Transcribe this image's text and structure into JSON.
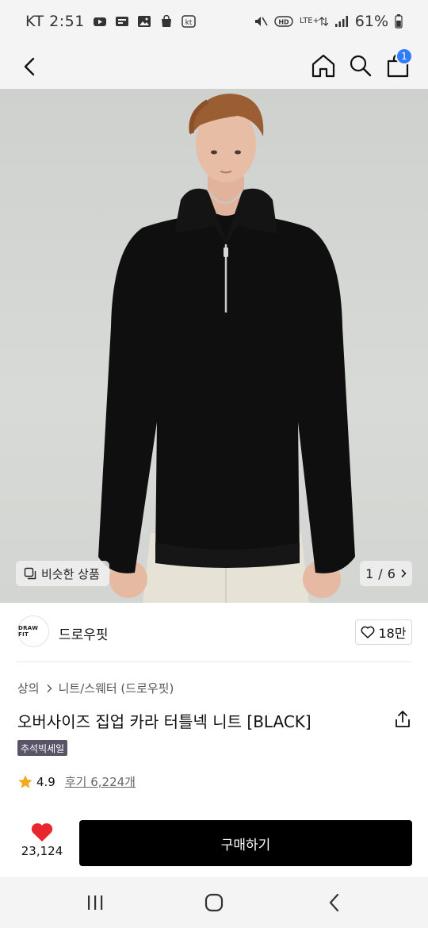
{
  "status_bar": {
    "carrier_time": "KT 2:51",
    "carrier_badge": "kt",
    "network": "LTE+",
    "hd_label": "HD",
    "battery": "61%",
    "icons": [
      "youtube-icon",
      "message-icon",
      "gallery-icon",
      "shopping-bag-icon",
      "kt-icon",
      "mute-icon",
      "hd-voice-icon",
      "lte-icon",
      "signal-icon",
      "battery-icon"
    ]
  },
  "header": {
    "icons": [
      "back-arrow-icon",
      "home-icon",
      "search-icon",
      "shopping-bag-icon"
    ],
    "cart_badge": "1"
  },
  "image_overlay": {
    "similar_label": "비슷한 상품",
    "page_current": "1",
    "page_total": "6",
    "page_separator": "/"
  },
  "brand": {
    "logo_text": "DRAW FIT",
    "name": "드로우핏",
    "like_count": "18만"
  },
  "product": {
    "breadcrumb": [
      "상의",
      "니트/스웨터 (드로우핏)"
    ],
    "title": "오버사이즈 집업 카라 터틀넥 니트 [BLACK]",
    "sale_tag": "추석빅세일",
    "rating": "4.9",
    "review_label": "후기 6,224개"
  },
  "purchase": {
    "wish_count": "23,124",
    "buy_label": "구매하기"
  },
  "colors": {
    "accent_badge": "#2f7df6",
    "sale_tag": "#5a5468",
    "heart": "#e8262d",
    "star": "#f2a91b",
    "buy_button": "#000000"
  }
}
